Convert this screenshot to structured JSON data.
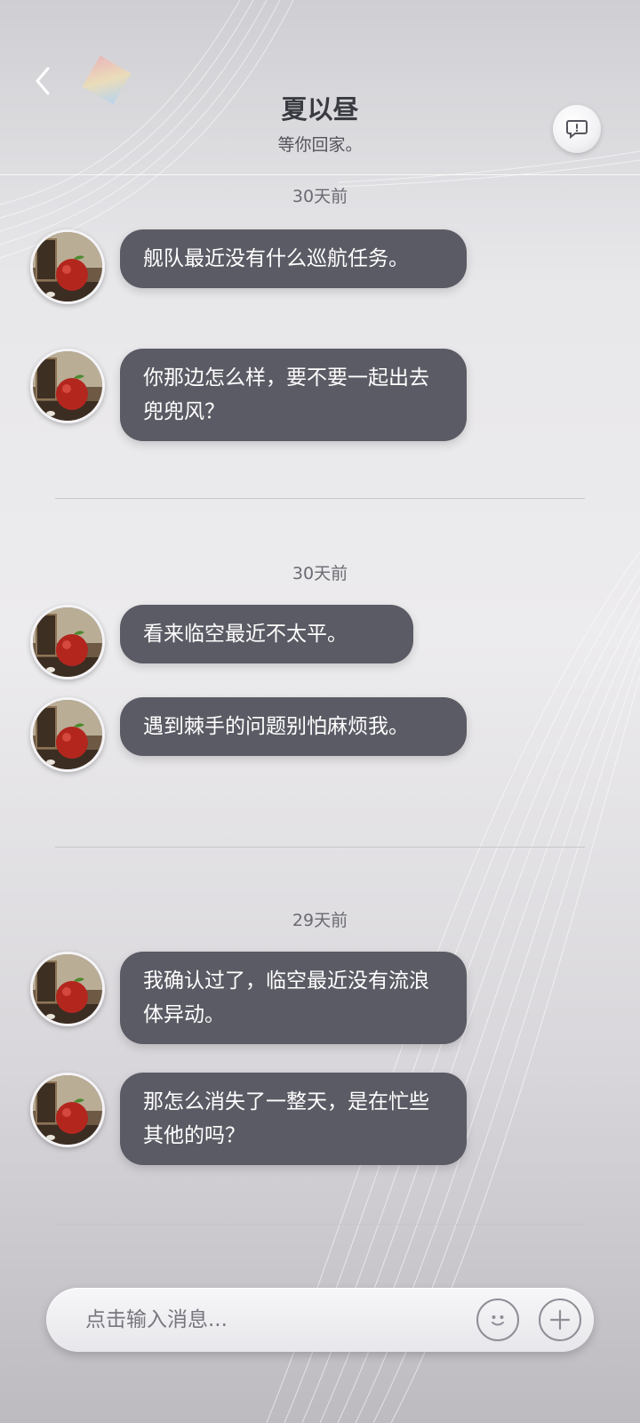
{
  "header": {
    "back_icon": "chevron-left-icon",
    "title": "夏以昼",
    "subtitle": "等你回家。",
    "chat_icon": "message-bubble-icon"
  },
  "messages": {
    "group1": {
      "time": "30天前",
      "m1": "舰队最近没有什么巡航任务。",
      "m2": "你那边怎么样，要不要一起出去兜兜风？"
    },
    "group2": {
      "time": "30天前",
      "m1": "看来临空最近不太平。",
      "m2": "遇到棘手的问题别怕麻烦我。"
    },
    "group3": {
      "time": "29天前",
      "m1": "我确认过了，临空最近没有流浪体异动。",
      "m2": "那怎么消失了一整天，是在忙些其他的吗？"
    }
  },
  "composer": {
    "placeholder": "点击输入消息...",
    "emoji_icon": "emoji-face-icon",
    "plus_icon": "plus-icon"
  },
  "colors": {
    "bubble": "#5b5b65",
    "title": "#3a3a42"
  }
}
